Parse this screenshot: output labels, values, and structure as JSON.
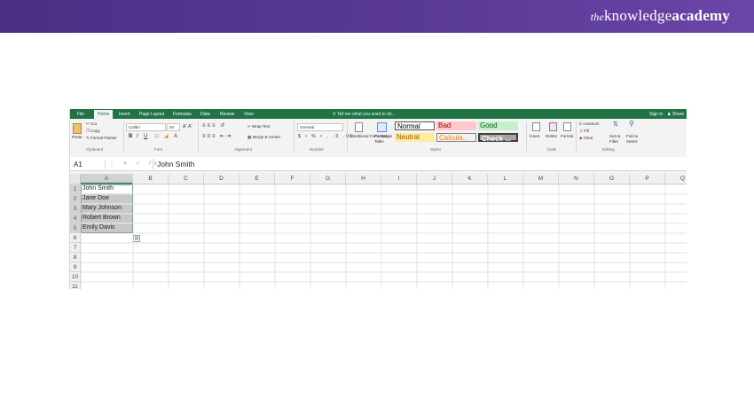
{
  "brand": {
    "the": "the",
    "knowledge": "knowledge",
    "academy": "academy"
  },
  "tabs": [
    "File",
    "Home",
    "Insert",
    "Page Layout",
    "Formulas",
    "Data",
    "Review",
    "View"
  ],
  "active_tab": "Home",
  "tell_me": "Tell me what you want to do...",
  "sign_in": "Sign in",
  "share": "Share",
  "ribbon": {
    "paste": "Paste",
    "cut": "Cut",
    "copy": "Copy",
    "format_painter": "Format Painter",
    "clipboard": "Clipboard",
    "font_name": "Calibri",
    "font_size": "20",
    "font_group": "Font",
    "wrap_text": "Wrap Text",
    "merge_center": "Merge & Center",
    "alignment": "Alignment",
    "number_format": "General",
    "number_group": "Number",
    "conditional_formatting": "Conditional Formatting",
    "format_as_table": "Format as Table",
    "styles_group": "Styles",
    "style_normal": "Normal",
    "style_bad": "Bad",
    "style_good": "Good",
    "style_neutral": "Neutral",
    "style_calculation": "Calcula...",
    "style_check": "Check ...",
    "insert": "Insert",
    "delete": "Delete",
    "format": "Format",
    "cells_group": "Cells",
    "autosum": "AutoSum",
    "fill": "Fill",
    "clear": "Clear",
    "sort_filter": "Sort & Filter",
    "find_select": "Find & Select",
    "editing_group": "Editing"
  },
  "formula_bar": {
    "name_box": "A1",
    "value": "John Smith"
  },
  "columns": [
    "A",
    "B",
    "C",
    "D",
    "E",
    "F",
    "G",
    "H",
    "I",
    "J",
    "K",
    "L",
    "M",
    "N",
    "O",
    "P",
    "Q"
  ],
  "rows": [
    "1",
    "2",
    "3",
    "4",
    "5",
    "6",
    "7",
    "8",
    "9",
    "10",
    "11"
  ],
  "cells_A": [
    "John Smith",
    "Jane Doe",
    "Mary Johnson",
    "Robert Brown",
    "Emily Davis"
  ],
  "colors": {
    "excel_green": "#217346",
    "banner": "#4b2f86"
  }
}
